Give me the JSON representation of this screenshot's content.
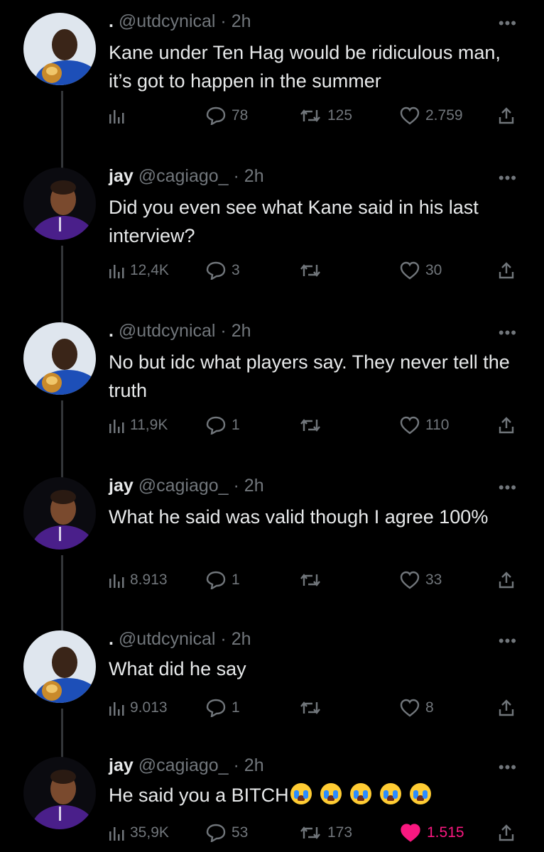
{
  "colors": {
    "background": "#000000",
    "text": "#e7e9ea",
    "muted": "#71767b",
    "like_active": "#f91880"
  },
  "icons": {
    "views": "bar-chart-icon",
    "reply": "speech-bubble-icon",
    "retweet": "retweet-arrows-icon",
    "like": "heart-icon",
    "share": "share-upload-icon",
    "more": "ellipsis-icon"
  },
  "tweets": [
    {
      "name": ".",
      "handle": "@utdcynical",
      "time": "· 2h",
      "text": "Kane under Ten Hag would be ridiculous man, it’s got to happen in the summer",
      "views": "",
      "replies": "78",
      "retweets": "125",
      "likes": "2.759"
    },
    {
      "name": "jay",
      "handle": "@cagiago_",
      "time": "· 2h",
      "text": "Did you even see what Kane said in his last interview?",
      "views": "12,4K",
      "replies": "3",
      "retweets": "",
      "likes": "30"
    },
    {
      "name": ".",
      "handle": "@utdcynical",
      "time": "· 2h",
      "text": "No but idc what players say. They never tell the truth",
      "views": "11,9K",
      "replies": "1",
      "retweets": "",
      "likes": "110"
    },
    {
      "name": "jay",
      "handle": "@cagiago_",
      "time": "· 2h",
      "text": "What he said was valid though I agree 100%",
      "views": "8.913",
      "replies": "1",
      "retweets": "",
      "likes": "33"
    },
    {
      "name": ".",
      "handle": "@utdcynical",
      "time": "· 2h",
      "text": "What did he say",
      "views": "9.013",
      "replies": "1",
      "retweets": "",
      "likes": "8"
    },
    {
      "name": "jay",
      "handle": "@cagiago_",
      "time": "· 2h",
      "text": "He said you a BITCH",
      "views": "35,9K",
      "replies": "53",
      "retweets": "173",
      "likes": "1.515",
      "liked": true
    }
  ]
}
